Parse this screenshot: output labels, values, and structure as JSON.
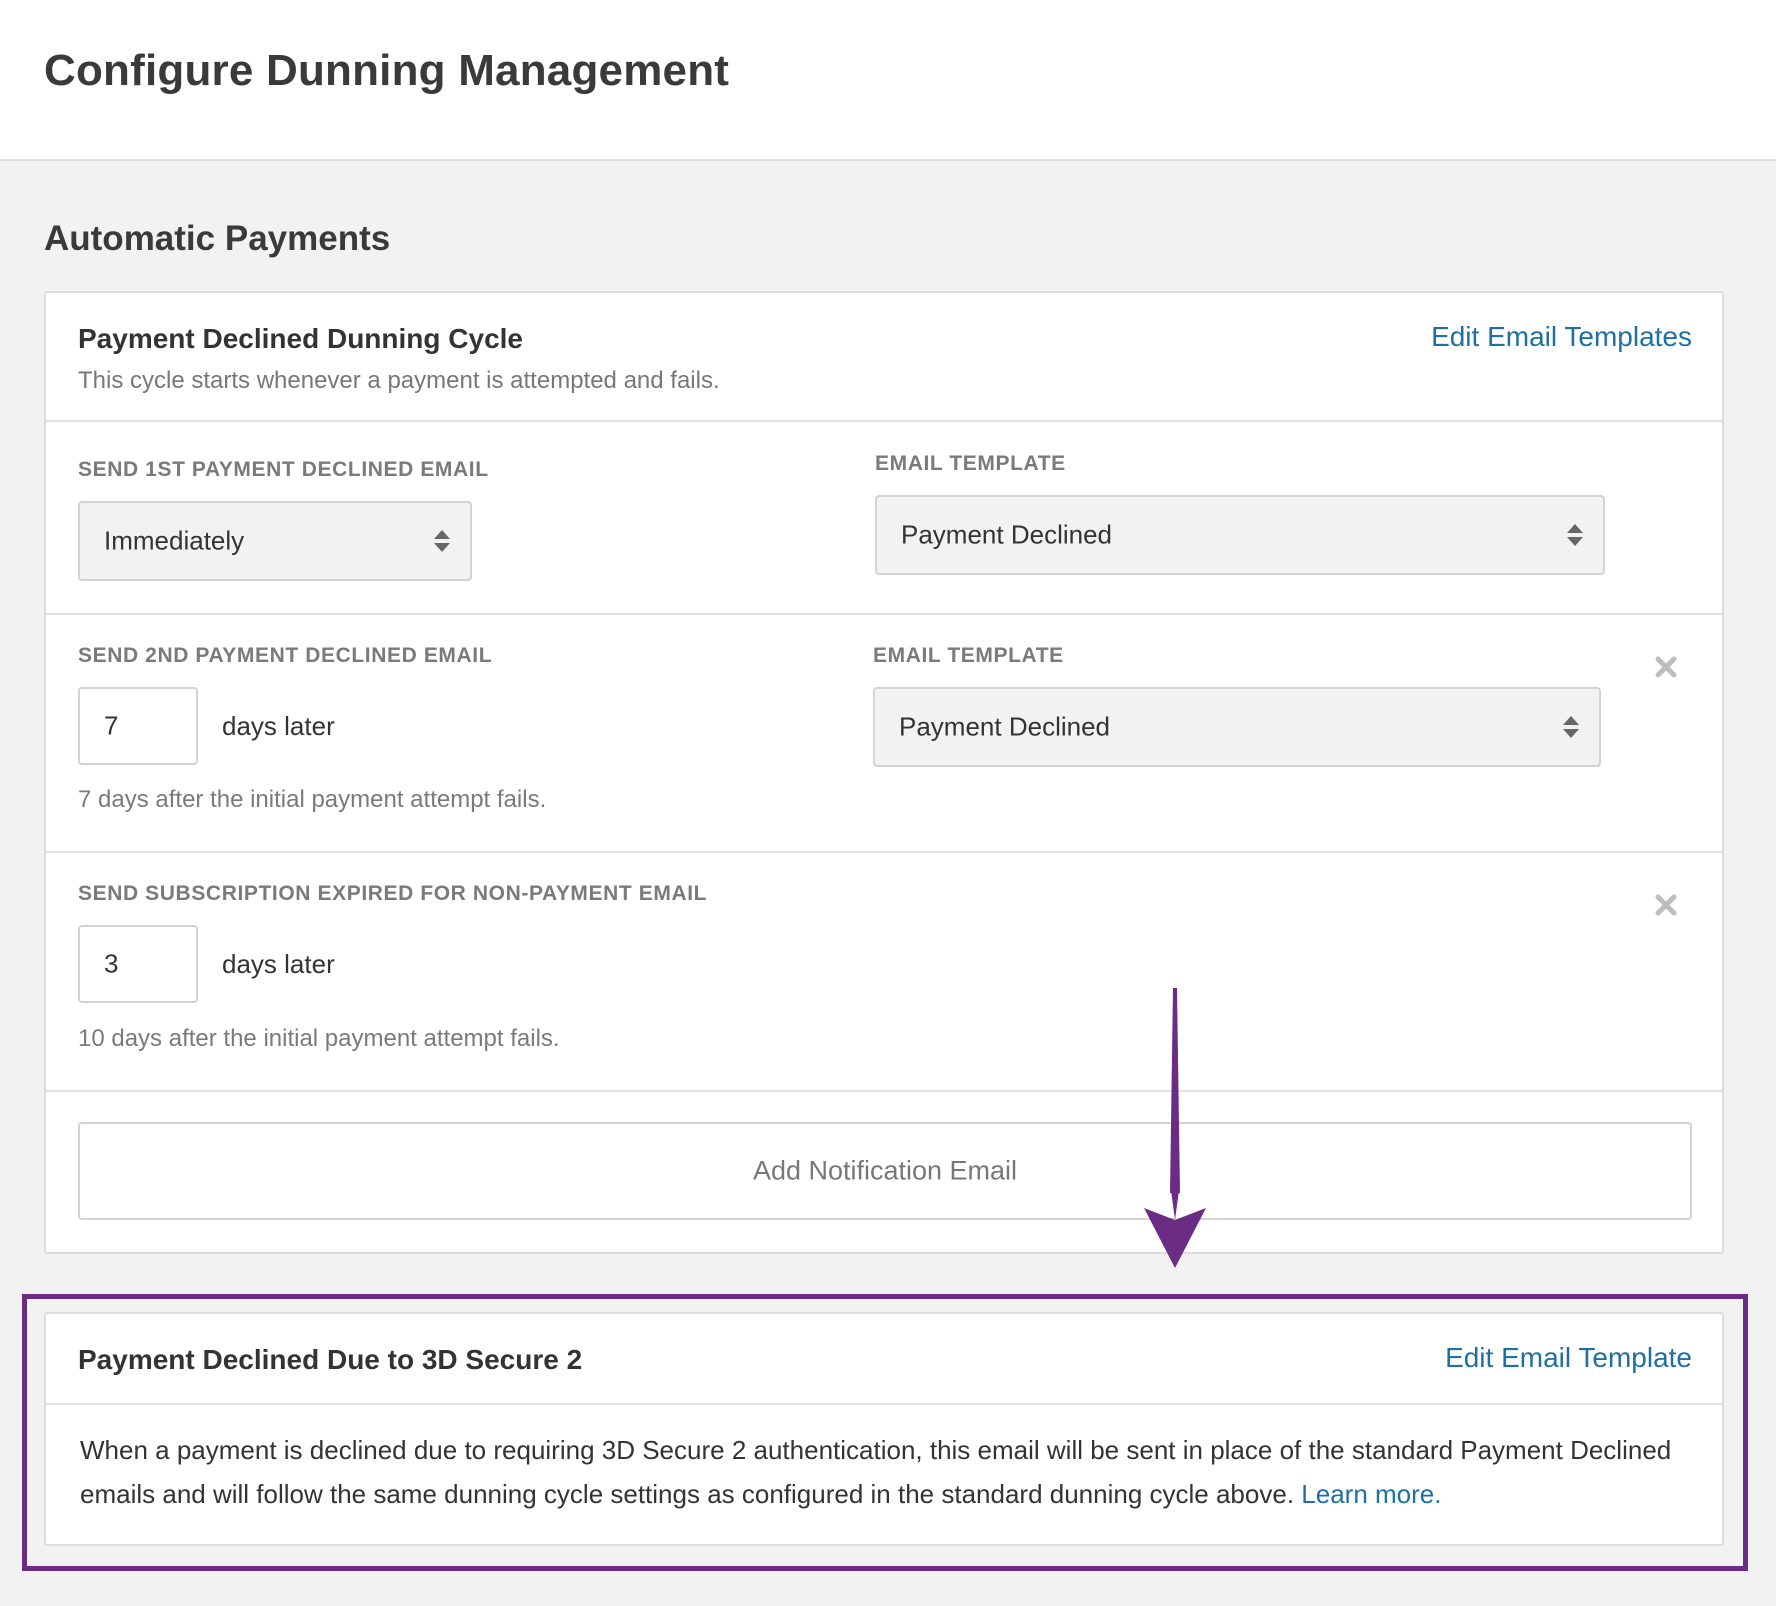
{
  "header": {
    "title": "Configure Dunning Management"
  },
  "section": {
    "title": "Automatic Payments"
  },
  "dunning_cycle": {
    "title": "Payment Declined Dunning Cycle",
    "subtitle": "This cycle starts whenever a payment is attempted and fails.",
    "edit_link": "Edit Email Templates",
    "steps": [
      {
        "label": "SEND 1ST PAYMENT DECLINED EMAIL",
        "timing": "Immediately",
        "template_label": "EMAIL TEMPLATE",
        "template": "Payment Declined"
      },
      {
        "label": "SEND 2ND PAYMENT DECLINED EMAIL",
        "days": "7",
        "suffix": "days later",
        "hint": "7 days after the initial payment attempt fails.",
        "template_label": "EMAIL TEMPLATE",
        "template": "Payment Declined"
      },
      {
        "label": "SEND SUBSCRIPTION EXPIRED FOR NON-PAYMENT EMAIL",
        "days": "3",
        "suffix": "days later",
        "hint": "10 days after the initial payment attempt fails."
      }
    ],
    "add_button": "Add Notification Email"
  },
  "secure_card": {
    "title": "Payment Declined Due to 3D Secure 2",
    "edit_link": "Edit Email Template",
    "body": "When a payment is declined due to requiring 3D Secure 2 authentication, this email will be sent in place of the standard Payment Declined emails and will follow the same dunning cycle settings as configured in the standard dunning cycle above.",
    "learn_more": "Learn more."
  },
  "colors": {
    "accent_link": "#1f6fa3",
    "annotation": "#6b2c84",
    "background": "#f2f2f2"
  },
  "icons": [
    "updown-caret-icon",
    "close-icon",
    "annotation-arrow-icon"
  ]
}
